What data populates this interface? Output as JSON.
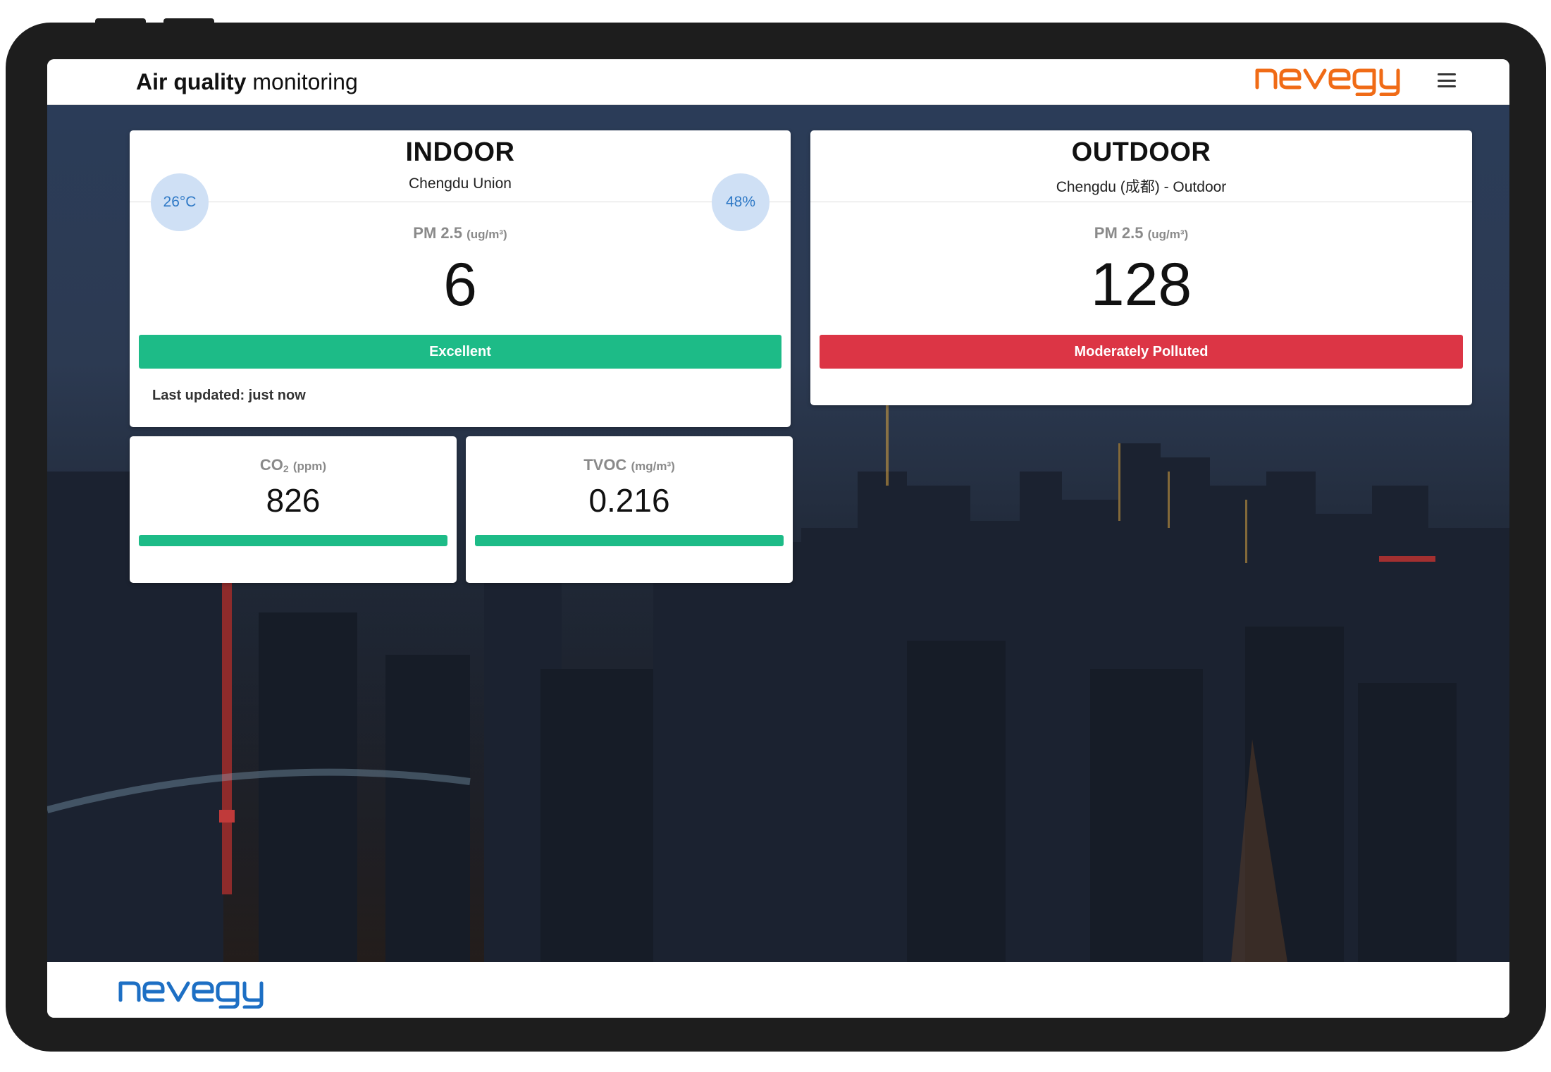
{
  "header": {
    "title_bold": "Air quality",
    "title_rest": " monitoring",
    "brand": "nevegy"
  },
  "indoor": {
    "title": "INDOOR",
    "location": "Chengdu Union",
    "temperature": "26°C",
    "humidity": "48%",
    "pm_label": "PM 2.5",
    "pm_unit": "(ug/m³)",
    "pm_value": "6",
    "status": "Excellent",
    "last_updated": "Last updated: just now"
  },
  "outdoor": {
    "title": "OUTDOOR",
    "location": "Chengdu (成都) - Outdoor",
    "pm_label": "PM 2.5",
    "pm_unit": "(ug/m³)",
    "pm_value": "128",
    "status": "Moderately Polluted"
  },
  "co2": {
    "label_main": "CO",
    "label_sub": "2",
    "unit": "(ppm)",
    "value": "826",
    "level": 1.0
  },
  "tvoc": {
    "label": "TVOC",
    "unit": "(mg/m³)",
    "value": "0.216",
    "level": 1.0
  },
  "footer": {
    "brand": "nevegy"
  },
  "colors": {
    "status_good": "#1dbb87",
    "status_bad": "#dc3545",
    "brand_orange": "#f06b16",
    "brand_blue": "#1d6fc4",
    "badge_bg": "#cfe0f5",
    "badge_text": "#2f79c6"
  }
}
